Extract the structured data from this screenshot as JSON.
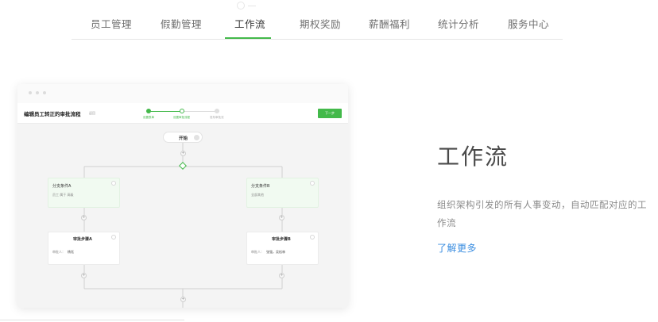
{
  "tabs": [
    {
      "label": "员工管理"
    },
    {
      "label": "假勤管理"
    },
    {
      "label": "工作流"
    },
    {
      "label": "期权奖励"
    },
    {
      "label": "薪酬福利"
    },
    {
      "label": "统计分析"
    },
    {
      "label": "服务中心"
    }
  ],
  "active_tab": "工作流",
  "accent_color": "#43b94a",
  "link_color": "#3a8de0",
  "mock": {
    "title": "编辑员工转正的审批流程",
    "subtitle": "返回",
    "next_button": "下一步",
    "steps": [
      "设置表单",
      "设置审批流程",
      "发布审批流"
    ],
    "start_label": "开始",
    "branches": [
      {
        "title": "分支条件A",
        "text": "员工 属于 高级"
      },
      {
        "title": "分支条件B",
        "text": "全部其他"
      }
    ],
    "approvals": [
      {
        "title": "审批步骤A",
        "label": "审批人：",
        "value": "杨钰"
      },
      {
        "title": "审批步骤B",
        "label": "审批人：",
        "value": "张强，吴松林"
      }
    ]
  },
  "hero": {
    "title": "工作流",
    "description": "组织架构引发的所有人事变动，自动匹配对应的工作流",
    "link": "了解更多"
  }
}
